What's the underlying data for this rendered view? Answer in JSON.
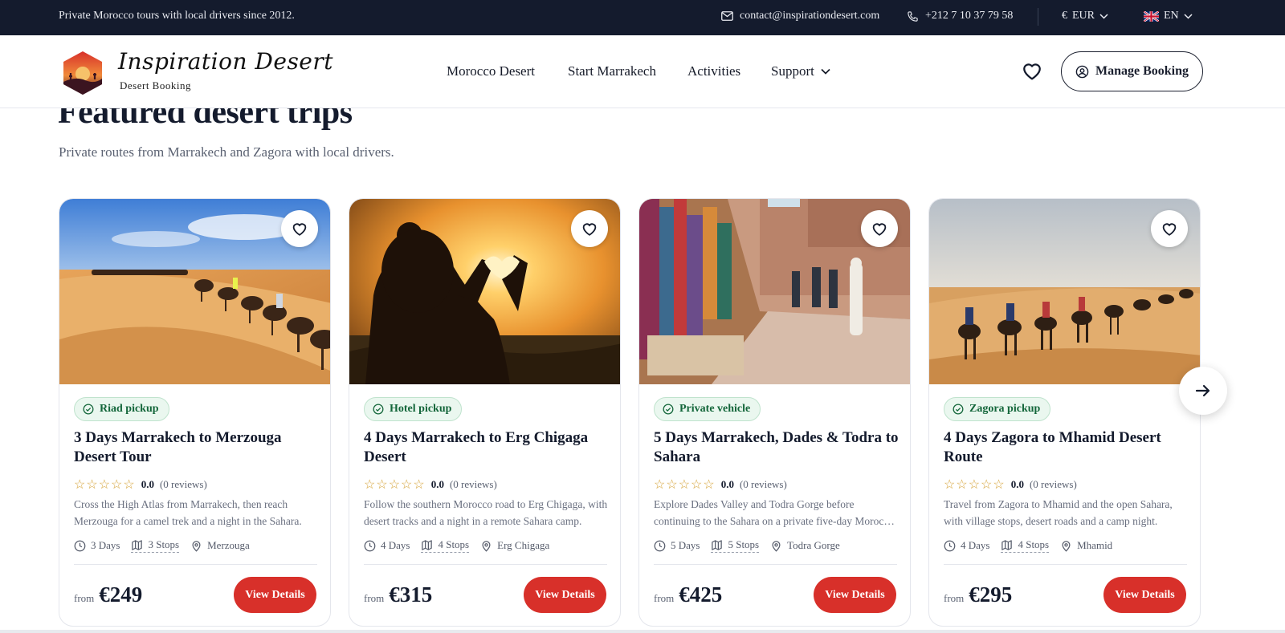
{
  "topbar": {
    "tagline": "Private Morocco tours with local drivers since 2012.",
    "email": "contact@inspirationdesert.com",
    "phone": "+212 7 10 37 79 58",
    "currency_symbol": "€",
    "currency": "EUR",
    "language": "EN",
    "icons": {
      "email": "mail-icon",
      "phone": "phone-icon",
      "chevron": "chevron-down-icon",
      "flag": "uk-flag-icon"
    }
  },
  "header": {
    "brand": "Inspiration Desert",
    "brand_sub": "Desert Booking",
    "nav": [
      "Morocco Desert",
      "Start Marrakech",
      "Activities",
      "Support"
    ],
    "manage_booking": "Manage Booking",
    "icons": {
      "wishlist": "heart-icon",
      "account": "user-circle-icon"
    }
  },
  "section": {
    "title": "Featured desert trips",
    "subtitle": "Private routes from Marrakech and Zagora with local drivers."
  },
  "cards": [
    {
      "badge": "Riad pickup",
      "title": "3 Days Marrakech to Merzouga Desert Tour",
      "rating": "0.0",
      "reviews": "(0 reviews)",
      "desc_line1": "Cross the High Atlas from Marrakech, then reach",
      "desc_line2": "Merzouga for a camel trek and a night in the Sahara.",
      "days": "3 Days",
      "stops": "3 Stops",
      "place": "Merzouga",
      "from": "from",
      "price": "€249",
      "cta": "View Details"
    },
    {
      "badge": "Hotel pickup",
      "title": "4 Days Marrakech to Erg Chigaga Desert",
      "rating": "0.0",
      "reviews": "(0 reviews)",
      "desc_line1": "Follow the southern Morocco road to Erg Chigaga, with",
      "desc_line2": "desert tracks and a night in a remote Sahara camp.",
      "days": "4 Days",
      "stops": "4 Stops",
      "place": "Erg Chigaga",
      "from": "from",
      "price": "€315",
      "cta": "View Details"
    },
    {
      "badge": "Private vehicle",
      "title": "5 Days Marrakech, Dades & Todra to Sahara",
      "rating": "0.0",
      "reviews": "(0 reviews)",
      "desc_line1": "Explore Dades Valley and Todra Gorge before",
      "desc_line2": "continuing to the Sahara on a private five-day Moroc…",
      "days": "5 Days",
      "stops": "5 Stops",
      "place": "Todra Gorge",
      "from": "from",
      "price": "€425",
      "cta": "View Details"
    },
    {
      "badge": "Zagora pickup",
      "title": "4 Days Zagora to Mhamid Desert Route",
      "rating": "0.0",
      "reviews": "(0 reviews)",
      "desc_line1": "Travel from Zagora to Mhamid and the open Sahara,",
      "desc_line2": "with village stops, desert roads and a camp night.",
      "days": "4 Days",
      "stops": "4 Stops",
      "place": "Mhamid",
      "from": "from",
      "price": "€295",
      "cta": "View Details"
    }
  ],
  "carousel": {
    "next_icon": "arrow-right-icon"
  },
  "colors": {
    "topbar_bg": "#141b2d",
    "accent_red": "#d8302a",
    "badge_green": "#13663a",
    "star_gold": "#d6a43a"
  }
}
